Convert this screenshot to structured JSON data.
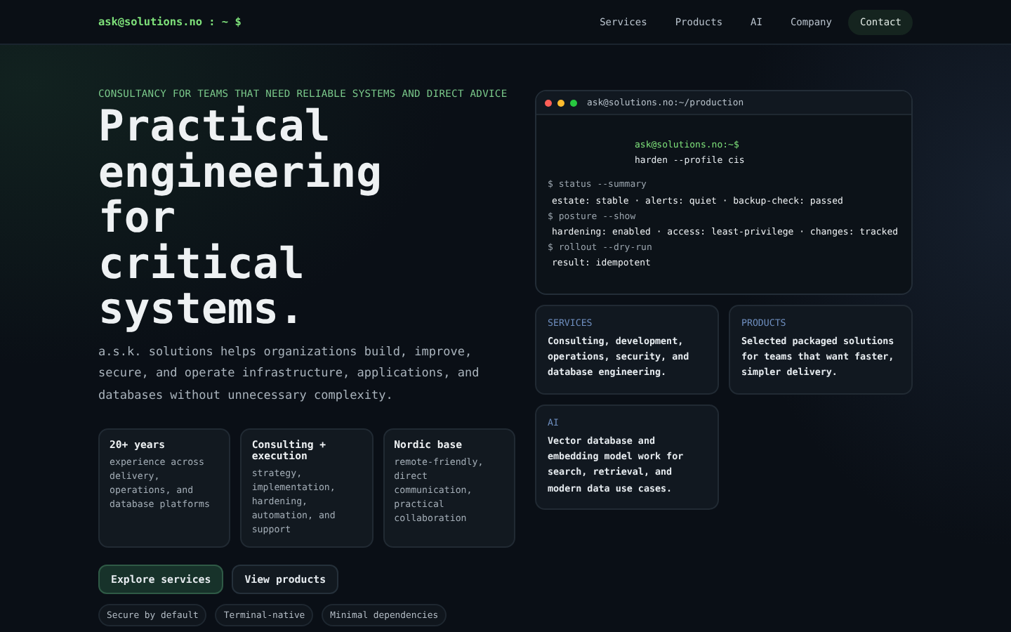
{
  "header": {
    "logo": "ask@solutions.no : ~ $",
    "links": [
      {
        "label": "Services",
        "kind": "link"
      },
      {
        "label": "Products",
        "kind": "link"
      },
      {
        "label": "AI",
        "kind": "link"
      },
      {
        "label": "Company",
        "kind": "link"
      },
      {
        "label": "Contact",
        "kind": "cta"
      }
    ]
  },
  "hero": {
    "eyebrow": "CONSULTANCY FOR TEAMS THAT NEED RELIABLE SYSTEMS AND DIRECT ADVICE",
    "title_lines": [
      "Practical",
      "engineering",
      "for",
      "critical",
      "systems."
    ],
    "intro": "a.s.k. solutions helps organizations build, improve, secure, and operate infrastructure, applications, and databases without unnecessary complexity.",
    "stats": [
      {
        "title": "20+ years",
        "text": "experience across delivery, operations, and database platforms"
      },
      {
        "title": "Consulting + execution",
        "text": "strategy, implementation, hardening, automation, and support"
      },
      {
        "title": "Nordic base",
        "text": "remote-friendly, direct communication, practical collaboration"
      }
    ],
    "buttons": [
      {
        "label": "Explore services",
        "kind": "primary"
      },
      {
        "label": "View products",
        "kind": "secondary"
      }
    ],
    "tags": [
      "Secure by default",
      "Terminal-native",
      "Minimal dependencies"
    ]
  },
  "terminal": {
    "title": "ask@solutions.no:~/production",
    "lines": [
      {
        "kind": "prompt",
        "text": "ask@solutions.no:~$"
      },
      {
        "kind": "continuation",
        "text": "harden --profile cis"
      },
      {
        "kind": "command",
        "text": "$ status --summary"
      },
      {
        "kind": "output",
        "text": "estate: stable · alerts: quiet · backup-check: passed"
      },
      {
        "kind": "command",
        "text": "$ posture --show"
      },
      {
        "kind": "output",
        "text": "hardening: enabled · access: least-privilege · changes: tracked"
      },
      {
        "kind": "command",
        "text": "$ rollout --dry-run"
      },
      {
        "kind": "output",
        "text": "result: idempotent"
      }
    ]
  },
  "cards": [
    {
      "label": "SERVICES",
      "text": "Consulting, development, operations, security, and database engineering."
    },
    {
      "label": "PRODUCTS",
      "text": "Selected packaged solutions for teams that want faster, simpler delivery."
    },
    {
      "label": "AI",
      "text": "Vector database and embedding model work for search, retrieval, and modern data use cases."
    }
  ]
}
